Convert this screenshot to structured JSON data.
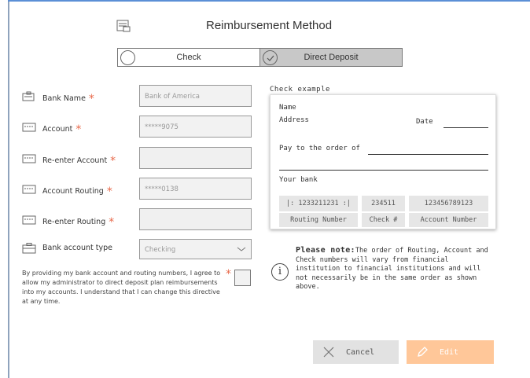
{
  "header": {
    "title": "Reimbursement Method",
    "icon": "document-money-icon"
  },
  "method": {
    "options": [
      {
        "label": "Check",
        "selected": false
      },
      {
        "label": "Direct Deposit",
        "selected": true
      }
    ]
  },
  "form": {
    "bank_name": {
      "label": "Bank Name",
      "value": "Bank of America",
      "icon": "bank-icon",
      "required": "*"
    },
    "account": {
      "label": "Account",
      "value": "*****9075",
      "icon": "card-icon",
      "required": "*"
    },
    "reenter_account": {
      "label": "Re-enter Account",
      "value": "",
      "icon": "card-icon",
      "required": "*"
    },
    "account_routing": {
      "label": "Account Routing",
      "value": "*****0138",
      "icon": "card-icon",
      "required": "*"
    },
    "reenter_routing": {
      "label": "Re-enter Routing",
      "value": "",
      "icon": "card-icon",
      "required": "*"
    },
    "account_type": {
      "label": "Bank account type",
      "value": "Checking",
      "icon": "briefcase-icon"
    }
  },
  "consent": {
    "text": "By providing my bank account and routing numbers, I agree to allow my administrator to direct deposit plan reimbursements into my accounts. I understand that I can change this directive at any time.",
    "required": "*"
  },
  "check_example": {
    "title": "Check example",
    "name": "Name",
    "address": "Address",
    "date": "Date",
    "pay_to": "Pay to the order of",
    "your_bank": "Your bank",
    "routing_value": "|: 1233211231 :|",
    "check_value": "234511",
    "account_value": "123456789123",
    "routing_label": "Routing Number",
    "check_label": "Check #",
    "account_label": "Account Number"
  },
  "note": {
    "heading": "Please note:",
    "text": "The order of Routing, Account and Check numbers will vary from financial institution to financial institutions and will not necessarily be in the same order as shown above.",
    "icon": "info-icon",
    "icon_glyph": "i"
  },
  "buttons": {
    "cancel": "Cancel",
    "edit": "Edit"
  },
  "colors": {
    "required": "#e8694a",
    "edit_button": "#ffc799",
    "accent_border": "#5b8fd6"
  }
}
